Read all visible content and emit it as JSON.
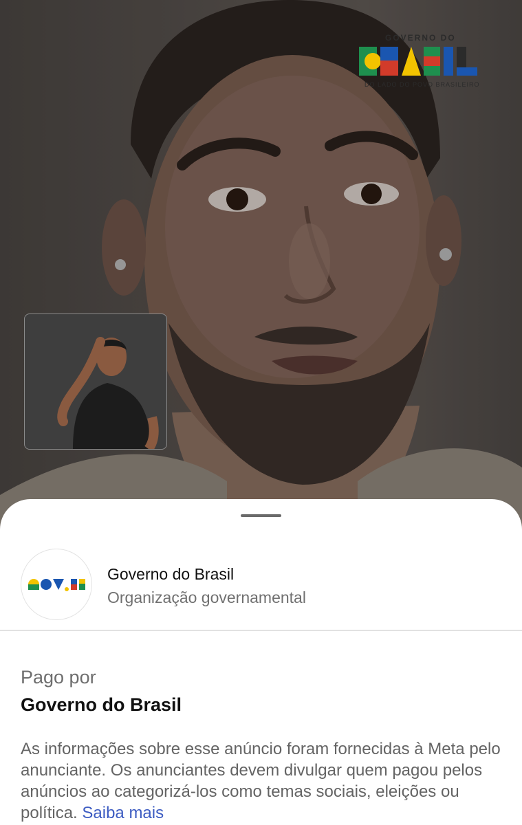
{
  "video": {
    "logo": {
      "top_text": "GOVERNO DO",
      "word": "BRASIL",
      "tagline": "DO LADO DO POVO BRASILEIRO",
      "colors": [
        "#1e8f4e",
        "#f2c300",
        "#1a56b0",
        "#d23b2a",
        "#2b2b2b"
      ]
    }
  },
  "sheet": {
    "advertiser": {
      "name": "Governo do Brasil",
      "category": "Organização governamental",
      "avatar_logo": "GOV.BR"
    },
    "paid_by": {
      "label": "Pago por",
      "value": "Governo do Brasil"
    },
    "disclaimer": {
      "text": "As informações sobre esse anúncio foram fornecidas à Meta pelo anunciante. Os anunciantes devem divulgar quem pagou pelos anúncios ao categorizá-los como temas sociais, eleições ou política.",
      "link_label": "Saiba mais"
    }
  },
  "colors": {
    "link": "#3d5cc2",
    "secondary_text": "#707070",
    "primary_text": "#111111"
  }
}
